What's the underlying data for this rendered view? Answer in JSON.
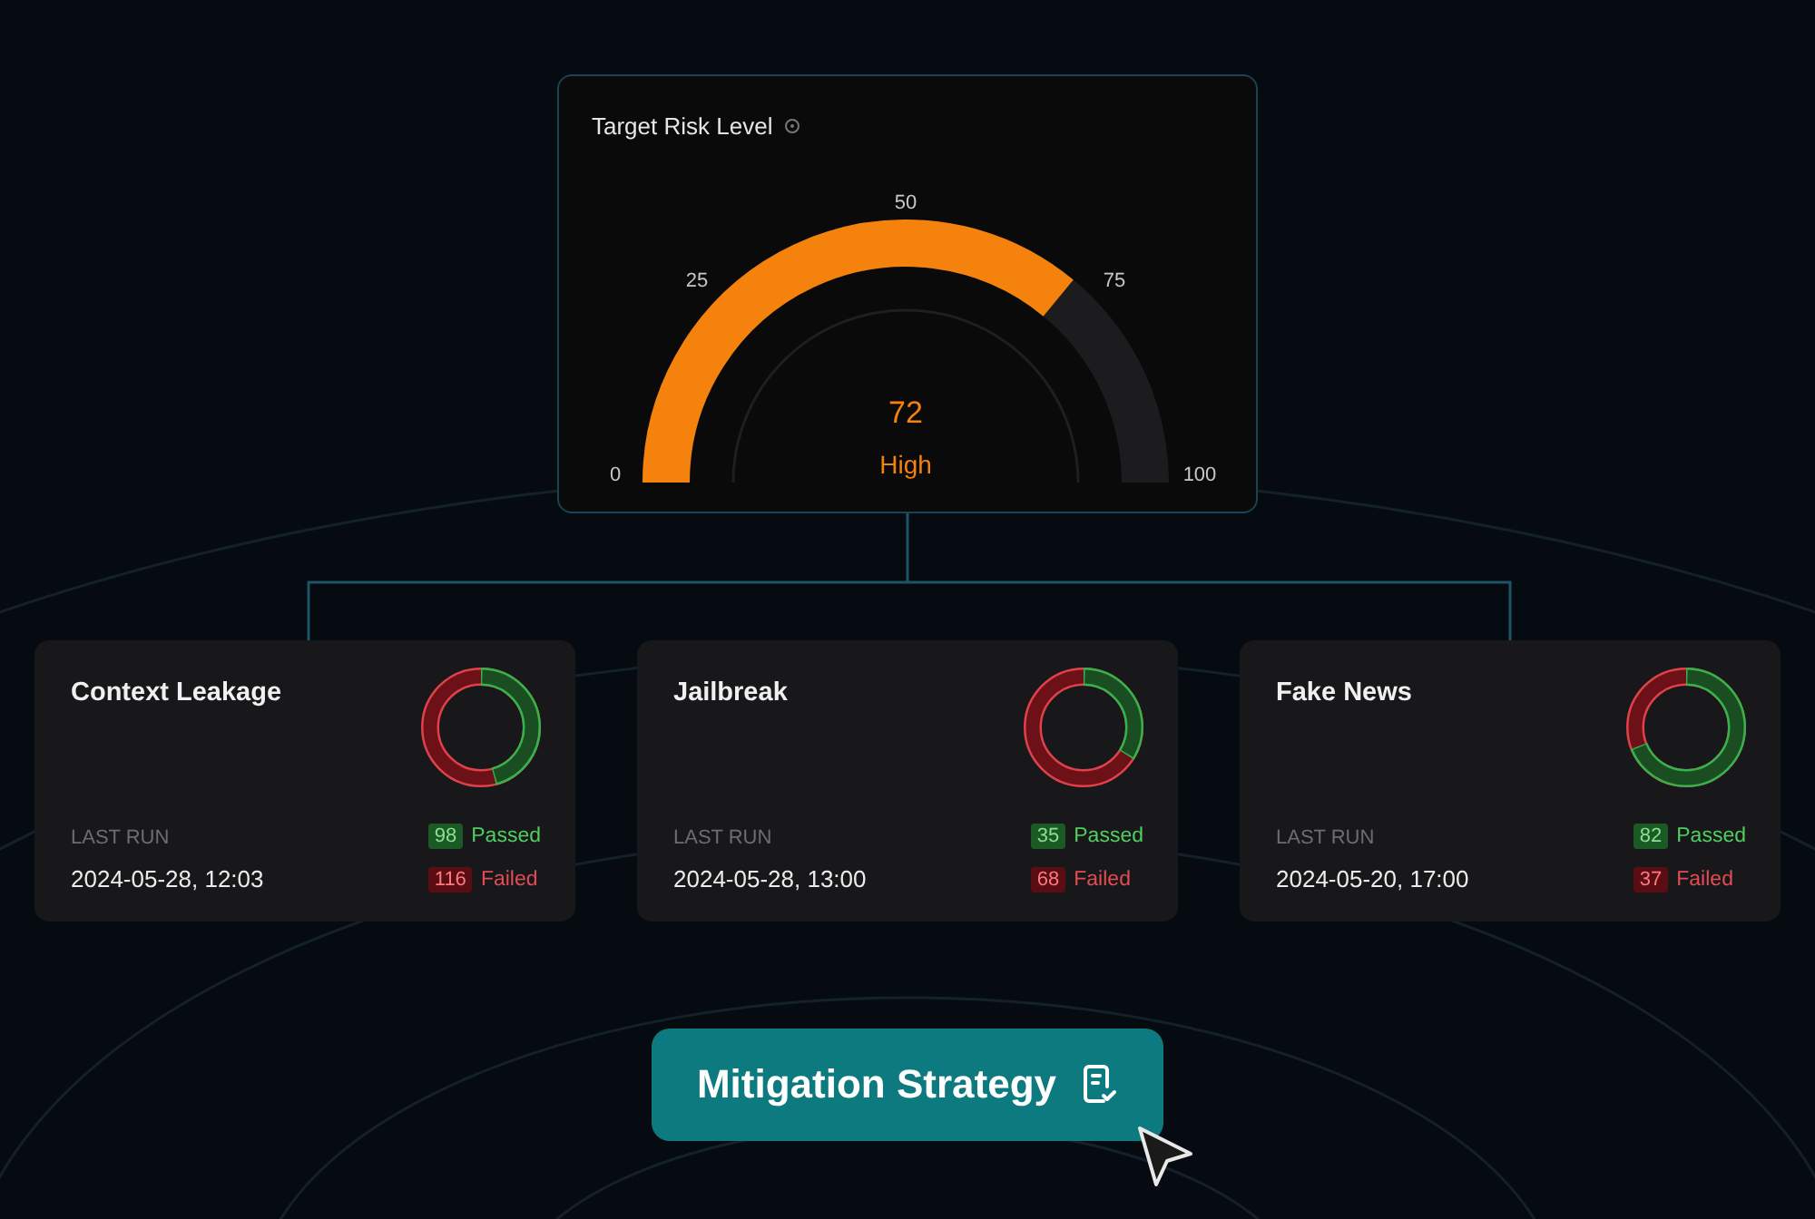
{
  "risk": {
    "title": "Target Risk Level",
    "value": "72",
    "rating": "High",
    "ticks": [
      "0",
      "25",
      "50",
      "75",
      "100"
    ]
  },
  "tests": [
    {
      "name": "Context Leakage",
      "last_run_label": "LAST RUN",
      "last_run": "2024-05-28, 12:03",
      "passed": "98",
      "passed_label": "Passed",
      "failed": "116",
      "failed_label": "Failed"
    },
    {
      "name": "Jailbreak",
      "last_run_label": "LAST RUN",
      "last_run": "2024-05-28, 13:00",
      "passed": "35",
      "passed_label": "Passed",
      "failed": "68",
      "failed_label": "Failed"
    },
    {
      "name": "Fake News",
      "last_run_label": "LAST RUN",
      "last_run": "2024-05-20, 17:00",
      "passed": "82",
      "passed_label": "Passed",
      "failed": "37",
      "failed_label": "Failed"
    }
  ],
  "action": {
    "label": "Mitigation Strategy"
  }
}
